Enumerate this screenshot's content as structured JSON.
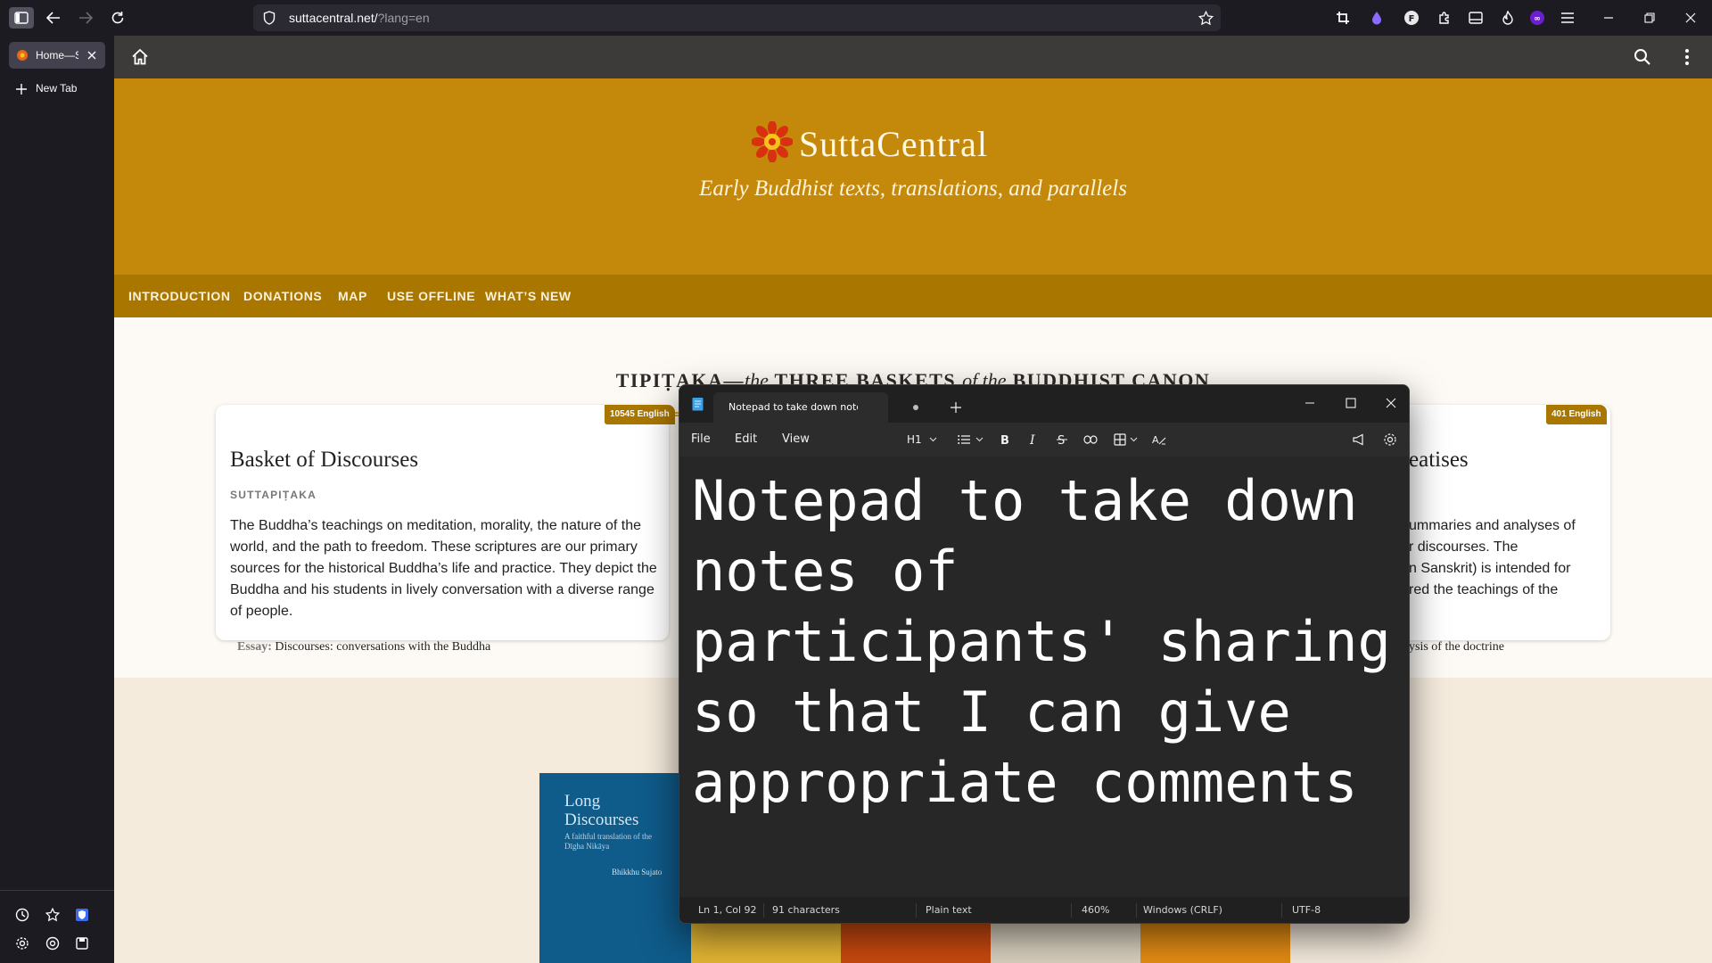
{
  "browser": {
    "url": "suttacentral.net/",
    "url_query": "?lang=en",
    "tabs": [
      {
        "label": "Home—SuttaCentral"
      }
    ],
    "new_tab_label": "New Tab"
  },
  "site": {
    "brand": "SuttaCentral",
    "tagline": "Early Buddhist texts, translations, and parallels",
    "nav": [
      "INTRODUCTION",
      "DONATIONS",
      "MAP",
      "USE OFFLINE",
      "WHAT’S NEW"
    ],
    "tipitaka_title": {
      "part1": "TIPIṬAKA",
      "dash": "—",
      "the1": "the",
      "part2": "THREE BASKETS",
      "ofthe": "of the",
      "part3": "BUDDHIST CANON"
    },
    "cards": [
      {
        "title": "Basket of Discourses",
        "subtitle": "SUTTAPIṬAKA",
        "badge": "10545 English",
        "desc": "The Buddha’s teachings on meditation, morality, the nature of the world, and the path to freedom. These scriptures are our primary sources for the historical Buddha’s life and practice. They depict the Buddha and his students in lively conversation with a diverse range of people.",
        "essay_label": "Essay:",
        "essay": "Discourses: conversations with the Buddha"
      },
      {
        "title": "eatises",
        "badge": "401 English",
        "desc_lines": [
          "ummaries and analyses of",
          "r discourses. The",
          "n Sanskrit) is intended for",
          "red the teachings of the"
        ],
        "essay": "ysis of the doctrine"
      }
    ],
    "books": [
      {
        "title": "Long Discourses",
        "subtitle": "A faithful translation of the Dīgha Nikāya",
        "author": "Bhikkhu Sujato",
        "color": "#0f5b8a"
      },
      {
        "color": "#e2b533"
      },
      {
        "color": "#c8490f"
      },
      {
        "color": "#d9d0bf"
      },
      {
        "color": "#e38c14"
      }
    ]
  },
  "notepad": {
    "tab_title": "Notepad to take down notes of participants' sharing so that I can give appropriate comments",
    "menu": [
      "File",
      "Edit",
      "View"
    ],
    "heading_label": "H1",
    "content": "Notepad to take down notes of participants' sharing so that I can give appropriate comments",
    "status": {
      "position": "Ln 1, Col 92",
      "characters": "91 characters",
      "format": "Plain text",
      "zoom": "460%",
      "line_ending": "Windows (CRLF)",
      "encoding": "UTF-8"
    }
  },
  "colors": {
    "hero": "#c4890a",
    "nav": "#a97600",
    "accent": "#d8a521"
  }
}
